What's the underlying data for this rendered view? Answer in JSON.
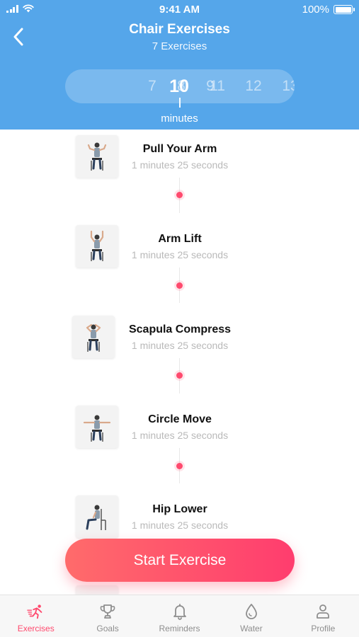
{
  "status_bar": {
    "time": "9:41 AM",
    "battery": "100%"
  },
  "header": {
    "title": "Chair Exercises",
    "subtitle": "7 Exercises"
  },
  "duration_picker": {
    "values": [
      "7",
      "8",
      "9",
      "10",
      "11",
      "12",
      "13"
    ],
    "selected": "10",
    "unit_label": "minutes"
  },
  "exercises": [
    {
      "name": "Pull Your Arm",
      "duration": "1 minutes 25 seconds",
      "pose": "arms-out-bent"
    },
    {
      "name": "Arm Lift",
      "duration": "1 minutes 25 seconds",
      "pose": "arms-up"
    },
    {
      "name": "Scapula Compress",
      "duration": "1 minutes 25 seconds",
      "pose": "hands-behind-head"
    },
    {
      "name": "Circle Move",
      "duration": "1 minutes 25 seconds",
      "pose": "arms-wide"
    },
    {
      "name": "Hip Lower",
      "duration": "1 minutes 25 seconds",
      "pose": "side-seated"
    }
  ],
  "cta": {
    "label": "Start Exercise"
  },
  "tabbar": {
    "items": [
      {
        "label": "Exercises",
        "icon": "running-person-icon",
        "active": true
      },
      {
        "label": "Goals",
        "icon": "trophy-icon",
        "active": false
      },
      {
        "label": "Reminders",
        "icon": "bell-icon",
        "active": false
      },
      {
        "label": "Water",
        "icon": "water-drop-icon",
        "active": false
      },
      {
        "label": "Profile",
        "icon": "person-icon",
        "active": false
      }
    ]
  },
  "colors": {
    "header": "#55A6EA",
    "accent": "#FF4A6E",
    "cta_start": "#FF6B6B",
    "cta_end": "#FF3D6E",
    "inactive": "#8E8E8E"
  }
}
